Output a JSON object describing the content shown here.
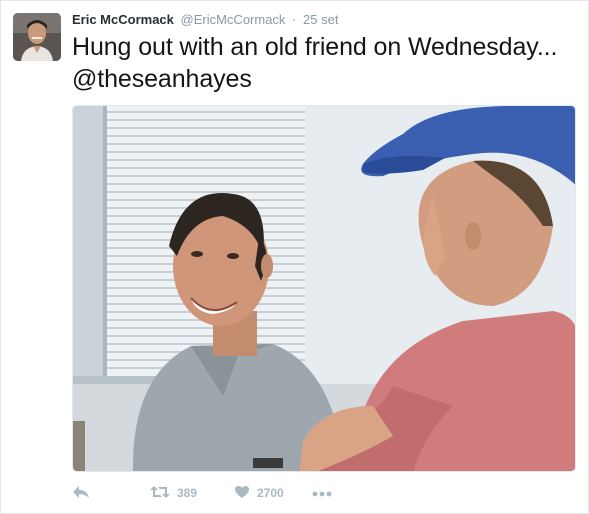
{
  "tweet": {
    "author_name": "Eric McCormack",
    "author_handle": "@EricMcCormack",
    "separator": "·",
    "timestamp": "25 set",
    "text": "Hung out with an old friend on Wednesday... @theseanhayes"
  },
  "actions": {
    "reply_icon": "reply-icon",
    "retweet_icon": "retweet-icon",
    "retweet_count": "389",
    "like_icon": "heart-icon",
    "like_count": "2700",
    "more_icon": "more-dots-icon"
  },
  "colors": {
    "name": "#292f33",
    "secondary": "#8899a6",
    "action_icon": "#aab8c2",
    "tweet_text": "#14171a"
  }
}
